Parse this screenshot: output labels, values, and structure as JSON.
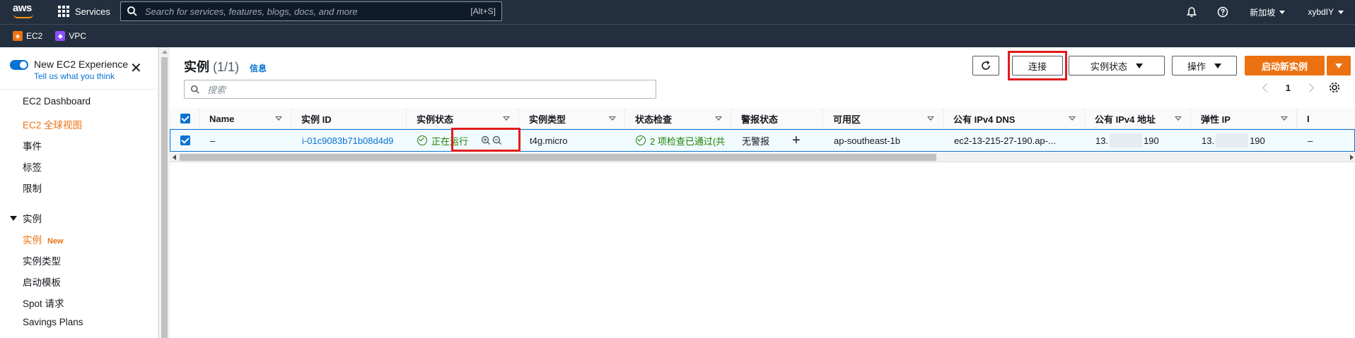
{
  "topnav": {
    "logo_text": "aws",
    "services_label": "Services",
    "search_placeholder": "Search for services, features, blogs, docs, and more",
    "search_shortcut": "[Alt+S]",
    "region": "新加坡",
    "account": "xybdIY",
    "icons": [
      "grid-icon",
      "search-icon",
      "bell-icon",
      "help-icon"
    ]
  },
  "favorites": [
    {
      "label": "EC2",
      "icon": "ec2-icon",
      "color": "#ec7211"
    },
    {
      "label": "VPC",
      "icon": "vpc-icon",
      "color": "#8c4fff"
    }
  ],
  "sidebar": {
    "experience_title": "New EC2 Experience",
    "experience_link": "Tell us what you think",
    "items": [
      {
        "label": "EC2 Dashboard",
        "active": false
      },
      {
        "label": "EC2 全球视图",
        "active": true
      },
      {
        "label": "事件",
        "active": false
      },
      {
        "label": "标签",
        "active": false
      },
      {
        "label": "限制",
        "active": false
      }
    ],
    "section": "实例",
    "section_items": [
      {
        "label": "实例",
        "badge": "New",
        "active": true
      },
      {
        "label": "实例类型",
        "active": false
      },
      {
        "label": "启动模板",
        "active": false
      },
      {
        "label": "Spot 请求",
        "active": false
      },
      {
        "label": "Savings Plans",
        "active": false
      }
    ]
  },
  "main": {
    "title": "实例",
    "count": "(1/1)",
    "info": "信息",
    "buttons": {
      "connect": "连接",
      "instance_state": "实例状态",
      "actions": "操作",
      "launch": "启动新实例"
    },
    "filter_placeholder": "搜索",
    "page": "1",
    "columns": [
      "Name",
      "实例 ID",
      "实例状态",
      "实例类型",
      "状态检查",
      "警报状态",
      "可用区",
      "公有 IPv4 DNS",
      "公有 IPv4 地址",
      "弹性 IP",
      "I"
    ],
    "row": {
      "name": "–",
      "instance_id": "i-01c9083b71b08d4d9",
      "state": "正在运行",
      "type": "t4g.micro",
      "status_check": "2 项检查已通过(共",
      "alarm": "无警报",
      "az": "ap-southeast-1b",
      "dns": "ec2-13-215-27-190.ap-...",
      "ipv4_prefix": "13.",
      "ipv4_suffix": "190",
      "eip_prefix": "13.",
      "eip_suffix": "190",
      "extra": "–"
    }
  },
  "colors": {
    "nav_bg": "#232f3e",
    "accent": "#ec7211",
    "link": "#0972d3",
    "success": "#1d8102",
    "highlight": "#e21b1b"
  }
}
